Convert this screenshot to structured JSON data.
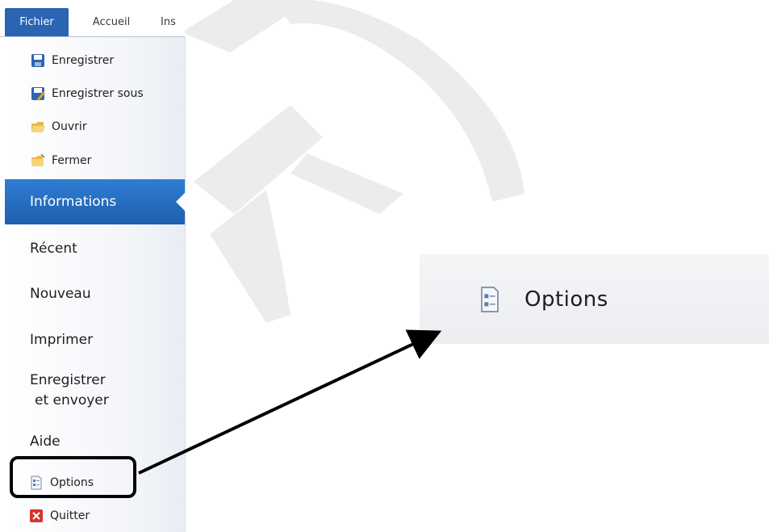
{
  "ribbon": {
    "tabs": [
      {
        "label": "Fichier",
        "active": true
      },
      {
        "label": "Accueil",
        "active": false
      },
      {
        "label": "Ins",
        "active": false
      }
    ]
  },
  "menu": {
    "commands_top": [
      {
        "label": "Enregistrer",
        "icon": "save-icon"
      },
      {
        "label": "Enregistrer sous",
        "icon": "save-as-icon"
      },
      {
        "label": "Ouvrir",
        "icon": "open-folder-icon"
      },
      {
        "label": "Fermer",
        "icon": "close-folder-icon"
      }
    ],
    "sections": [
      {
        "label": "Informations",
        "active": true
      },
      {
        "label": "Récent",
        "active": false
      },
      {
        "label": "Nouveau",
        "active": false
      },
      {
        "label": "Imprimer",
        "active": false
      },
      {
        "label": "Enregistrer",
        "label_line2": "et envoyer",
        "active": false
      },
      {
        "label": "Aide",
        "active": false
      }
    ],
    "commands_bottom": [
      {
        "label": "Options",
        "icon": "options-icon",
        "highlighted": true
      },
      {
        "label": "Quitter",
        "icon": "exit-icon"
      }
    ]
  },
  "zoom_callout": {
    "label": "Options",
    "icon": "options-icon"
  },
  "colors": {
    "file_tab": "#2a64b2",
    "active_section": "#2f7ed3",
    "callout_border": "#000000",
    "exit_icon": "#d9322a"
  }
}
